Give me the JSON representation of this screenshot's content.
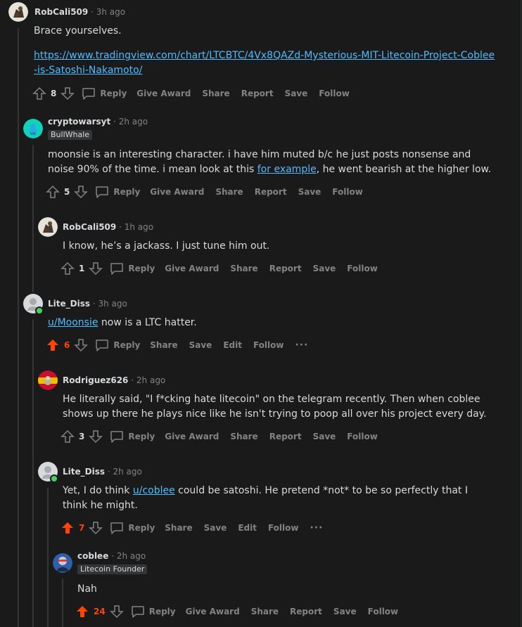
{
  "comments": [
    {
      "author": "RobCali509",
      "time": "3h ago",
      "body_text": "Brace yourselves.",
      "link": "https://www.tradingview.com/chart/LTCBTC/4Vx8QAZd-Mysterious-MIT-Litecoin-Project-Coblee-is-Satoshi-Nakamoto/",
      "score": "8",
      "actions": [
        "Reply",
        "Give Award",
        "Share",
        "Report",
        "Save",
        "Follow"
      ]
    },
    {
      "author": "cryptowarsyt",
      "time": "2h ago",
      "flair": "BullWhale",
      "body_before": "moonsie is an interesting character. i have him muted b/c he just posts nonsense and noise 90% of the time. i mean look at this ",
      "body_link": "for example",
      "body_after": ", he went bearish at the higher low.",
      "score": "5",
      "actions": [
        "Reply",
        "Give Award",
        "Share",
        "Report",
        "Save",
        "Follow"
      ]
    },
    {
      "author": "RobCali509",
      "time": "1h ago",
      "body_text": "I know, he’s a jackass. I just tune him out.",
      "score": "1",
      "actions": [
        "Reply",
        "Give Award",
        "Share",
        "Report",
        "Save",
        "Follow"
      ]
    },
    {
      "author": "Lite_Diss",
      "time": "3h ago",
      "body_link": "u/Moonsie",
      "body_after": " now is a LTC hatter.",
      "score": "6",
      "actions": [
        "Reply",
        "Share",
        "Save",
        "Edit",
        "Follow"
      ],
      "more": "···"
    },
    {
      "author": "Rodriguez626",
      "time": "2h ago",
      "body_text": "He literally said, \"I f*cking hate litecoin\" on the telegram recently. Then when coblee shows up there he plays nice like he isn't trying to poop all over his project every day.",
      "score": "3",
      "actions": [
        "Reply",
        "Give Award",
        "Share",
        "Report",
        "Save",
        "Follow"
      ]
    },
    {
      "author": "Lite_Diss",
      "time": "2h ago",
      "body_before": "Yet, I do think ",
      "body_link": "u/coblee",
      "body_after": " could be satoshi. He pretend *not* to be so perfectly that I think he might.",
      "score": "7",
      "actions": [
        "Reply",
        "Share",
        "Save",
        "Edit",
        "Follow"
      ],
      "more": "···"
    },
    {
      "author": "coblee",
      "time": "2h ago",
      "flair": "Litecoin Founder",
      "body_text": "Nah",
      "score": "24",
      "actions": [
        "Reply",
        "Give Award",
        "Share",
        "Report",
        "Save",
        "Follow"
      ]
    }
  ],
  "separator": "·",
  "colors": {
    "upvoted": "#ff4500",
    "link": "#4fbcff",
    "muted": "#818384",
    "text": "#d7dadc",
    "background": "#1a1a1b",
    "flair_bg": "#343536"
  }
}
